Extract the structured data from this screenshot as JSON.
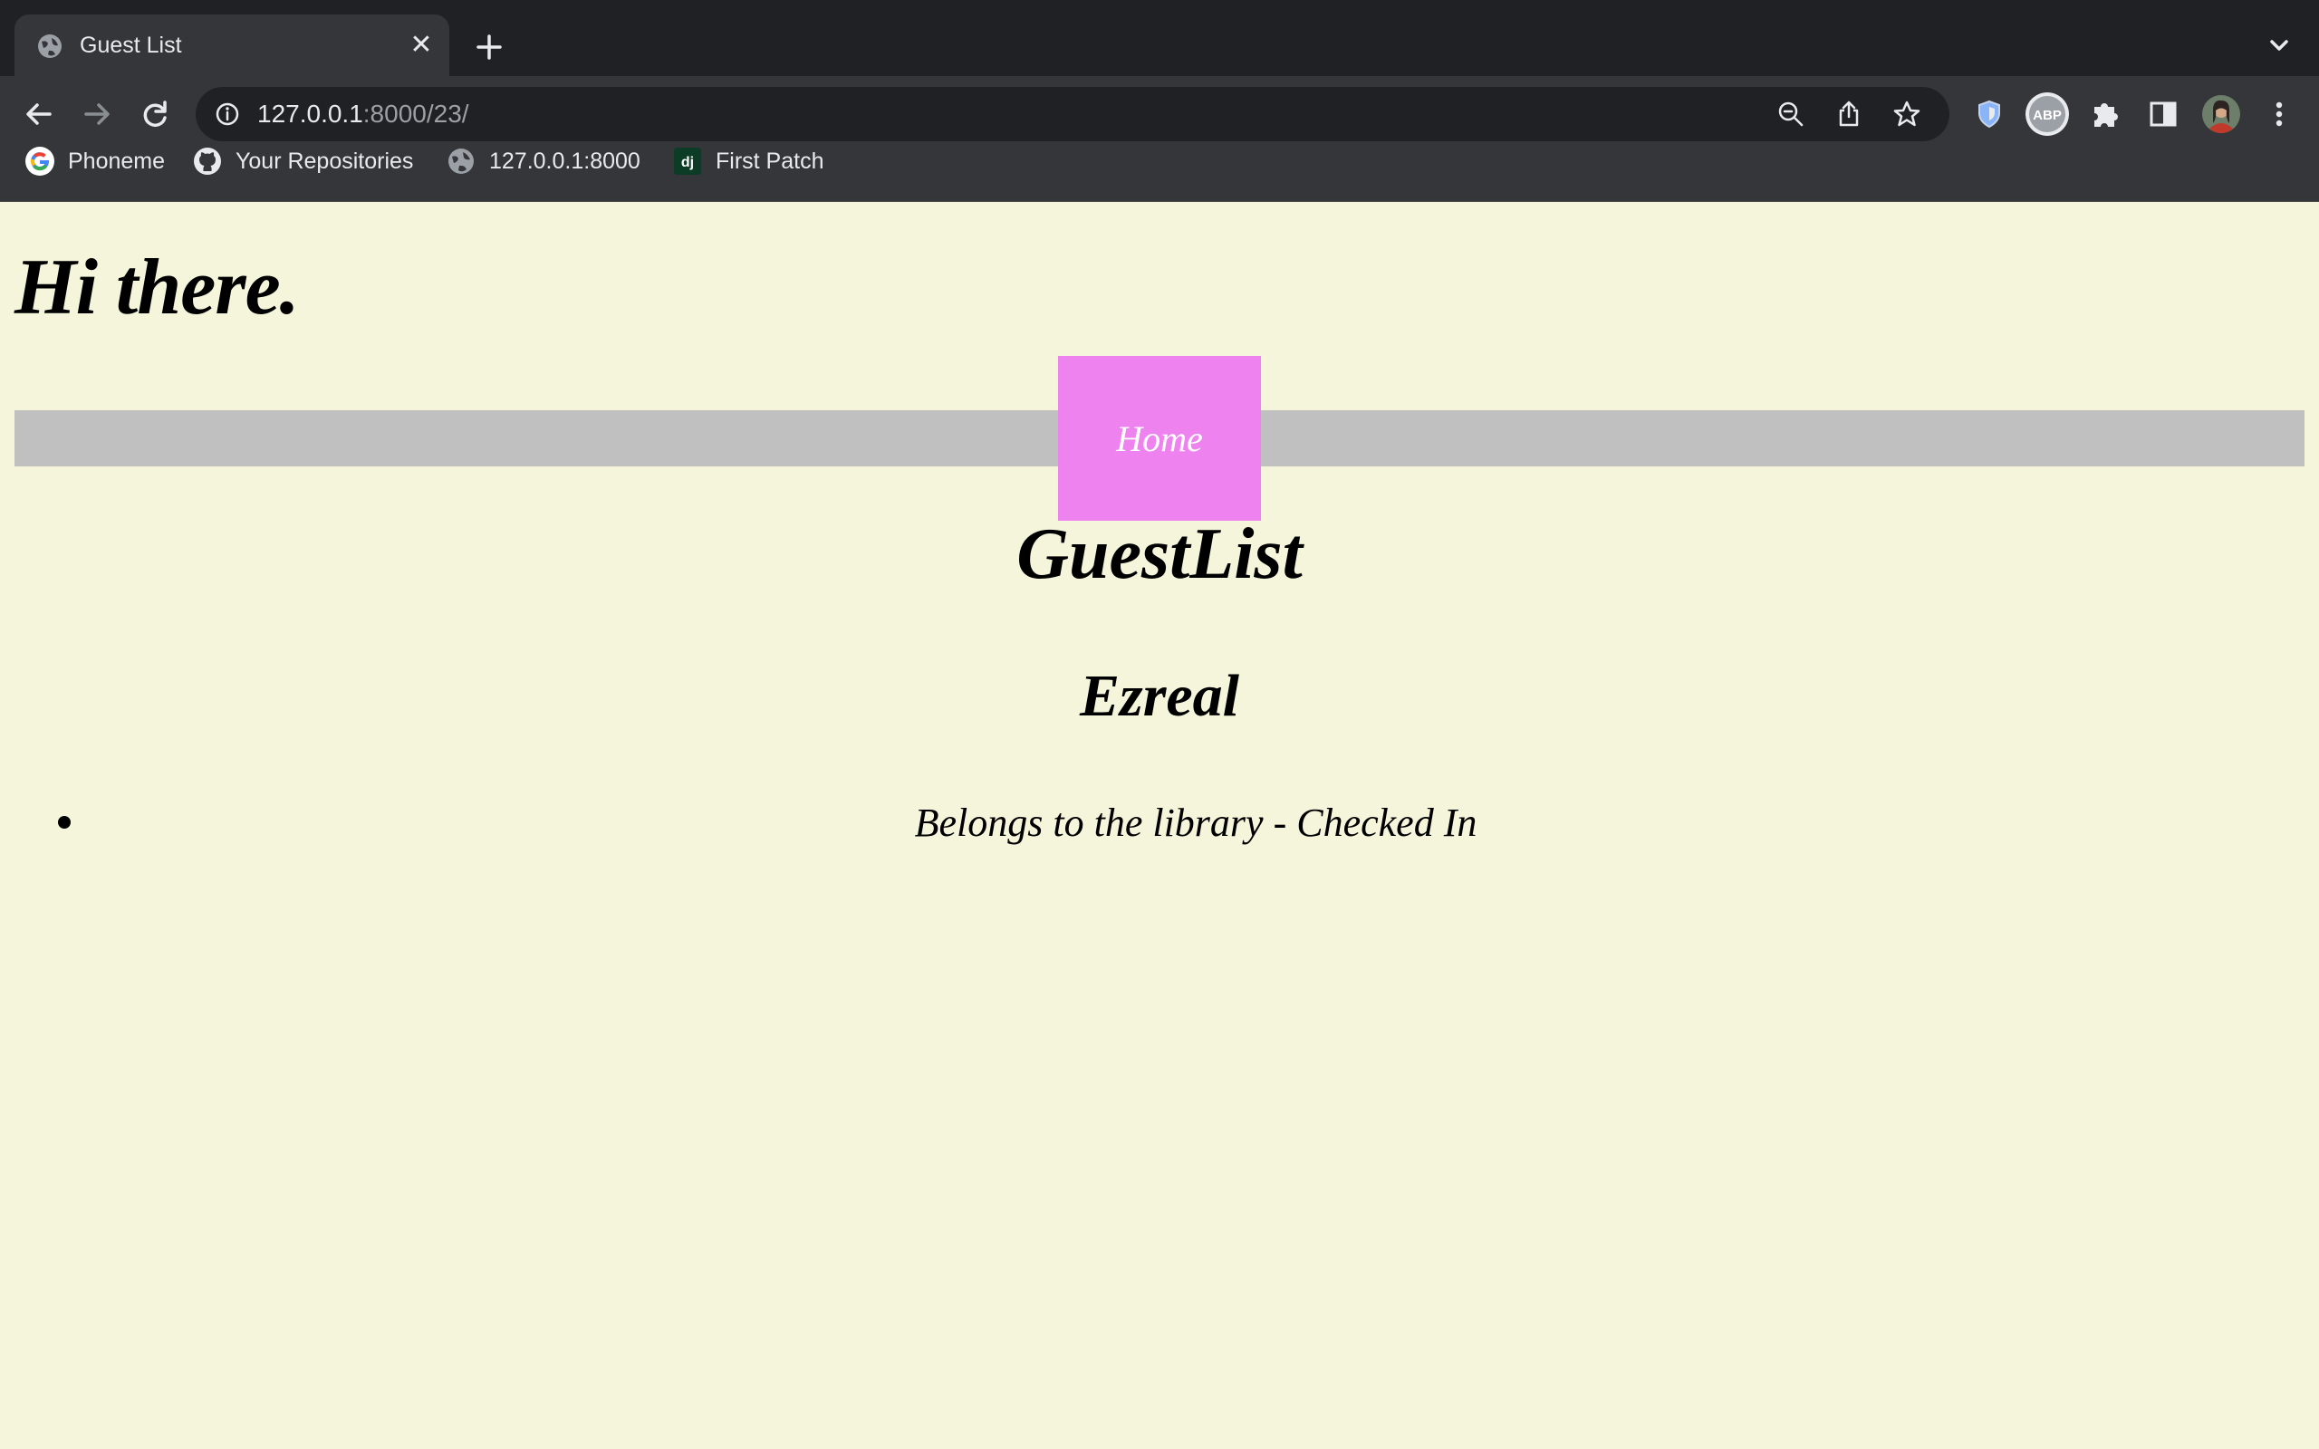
{
  "browser": {
    "tab": {
      "title": "Guest List",
      "close_glyph": "✕"
    },
    "address": {
      "host": "127.0.0.1",
      "path": ":8000/23/"
    },
    "bookmarks": [
      {
        "label": "Phoneme",
        "icon": "google-icon"
      },
      {
        "label": "Your Repositories",
        "icon": "github-icon"
      },
      {
        "label": "127.0.0.1:8000",
        "icon": "globe-icon"
      },
      {
        "label": "First Patch",
        "icon": "django-icon"
      }
    ],
    "extensions": [
      "shield-icon",
      "abp-icon",
      "puzzle-icon",
      "sidepanel-icon",
      "avatar",
      "more-icon"
    ],
    "colors": {
      "frame": "#202124",
      "toolbar": "#35363a",
      "text": "#e8eaed"
    }
  },
  "page": {
    "greeting": "Hi there.",
    "nav": {
      "home_label": "Home"
    },
    "heading": "GuestList",
    "guest_name": "Ezreal",
    "items": [
      "Belongs to the library - Checked In"
    ],
    "colors": {
      "background": "#f5f5dc",
      "navband": "#c0c0c0",
      "home_button": "#ee82ee"
    }
  }
}
